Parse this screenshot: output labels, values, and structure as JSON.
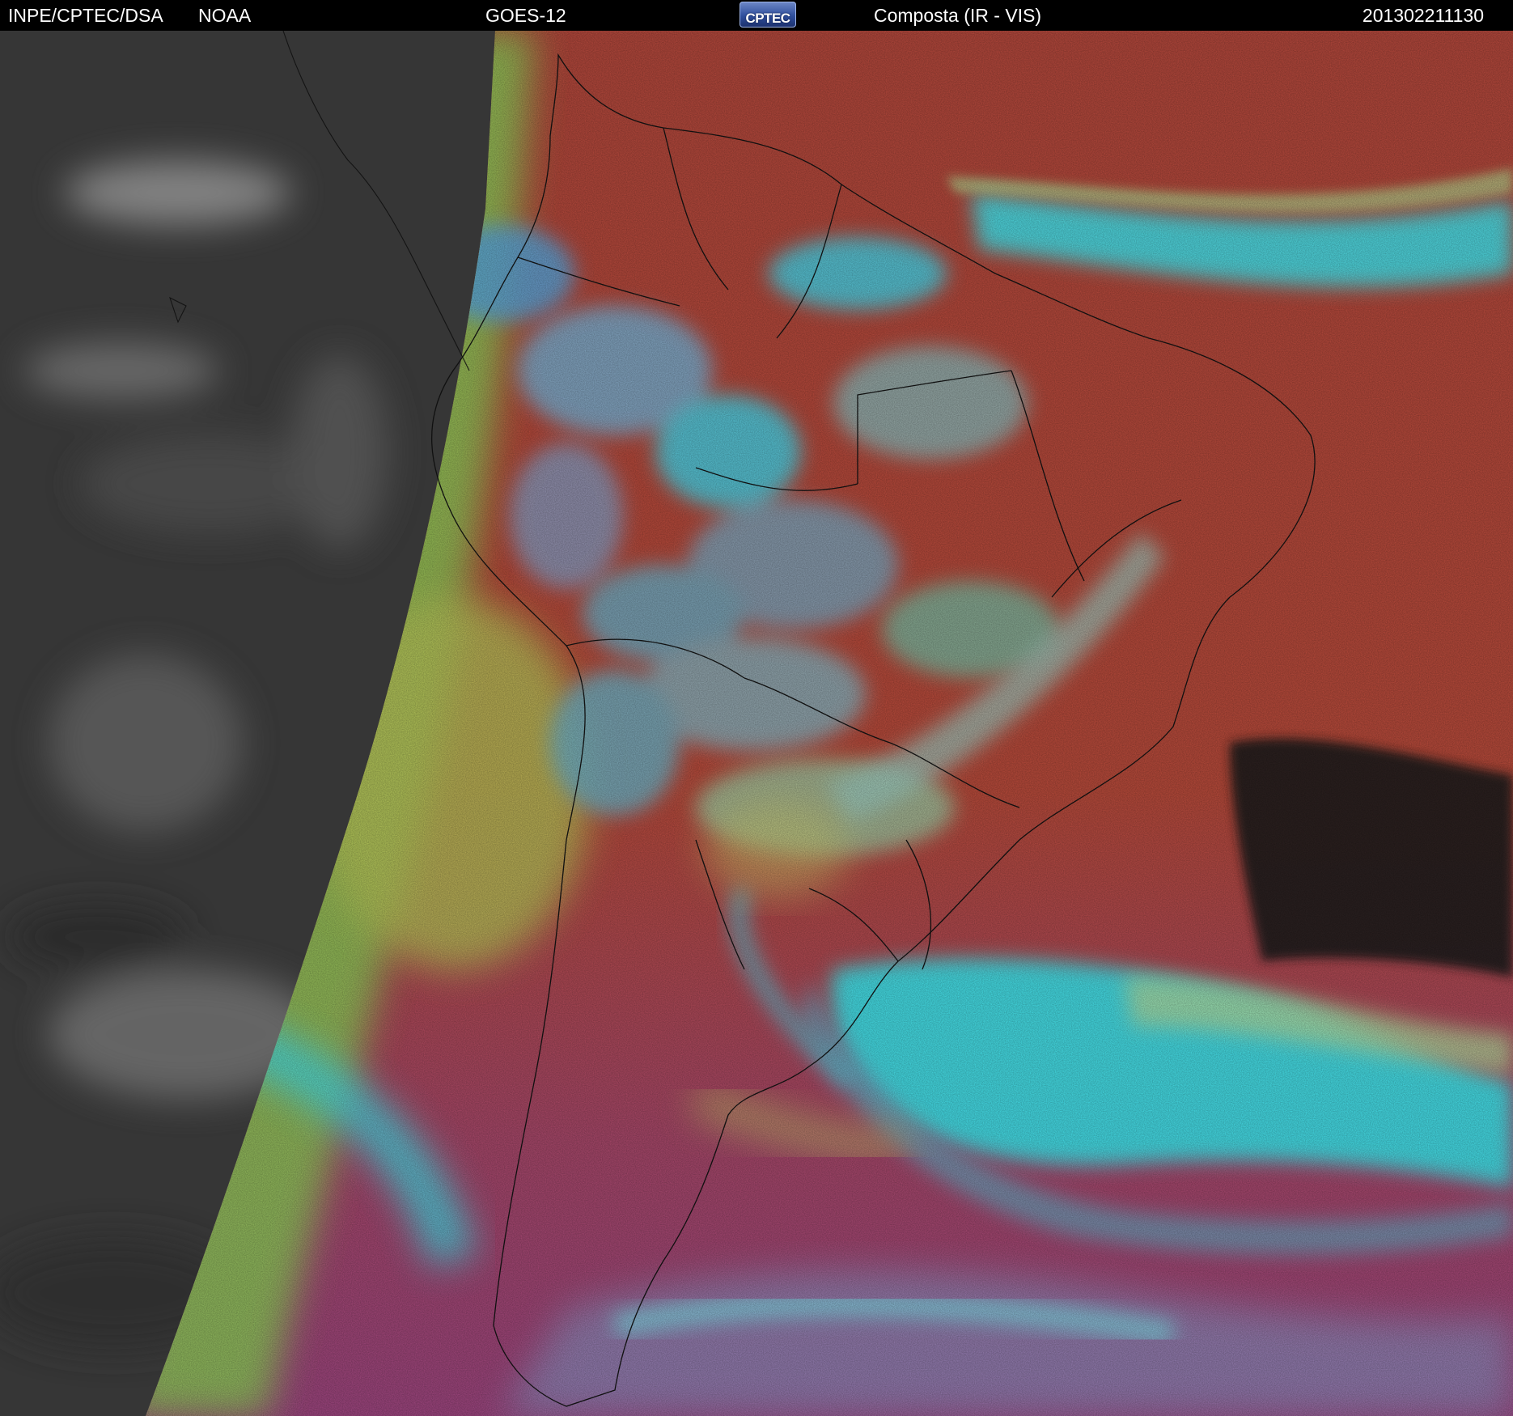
{
  "header": {
    "institution": "INPE/CPTEC/DSA",
    "agency": "NOAA",
    "satellite": "GOES-12",
    "logo_text": "CPTEC",
    "product": "Composta (IR - VIS)",
    "datetime": "201302211130"
  },
  "colors": {
    "title_bar_bg": "#000000",
    "title_text": "#ffffff",
    "night_side_gray": "#3a3a3a",
    "composite_red": "#b84a3c",
    "cloud_cyan": "#38e6ee",
    "cloud_green": "#9bdc5c",
    "cloud_magenta": "#a34a7e",
    "border_lines": "#111111"
  }
}
